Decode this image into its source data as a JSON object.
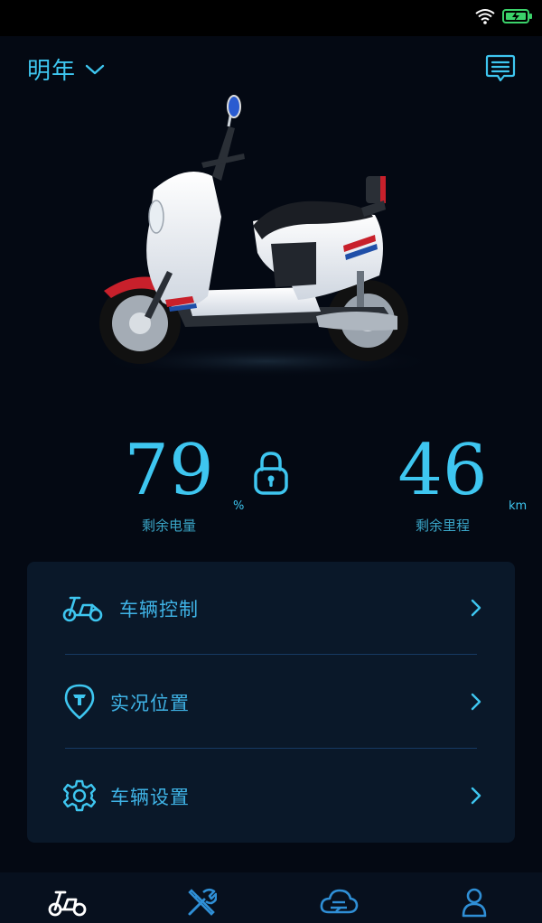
{
  "header": {
    "vehicle_name": "明年"
  },
  "stats": {
    "battery_value": "79",
    "battery_unit": "%",
    "battery_label": "剩余电量",
    "range_value": "46",
    "range_unit": "km",
    "range_label": "剩余里程"
  },
  "menu": {
    "items": [
      {
        "label": "车辆控制",
        "icon": "scooter-icon"
      },
      {
        "label": "实况位置",
        "icon": "location-pin-icon"
      },
      {
        "label": "车辆设置",
        "icon": "gear-icon"
      }
    ]
  },
  "tabbar": {
    "tabs": [
      {
        "icon": "scooter-icon",
        "active": true
      },
      {
        "icon": "tools-icon",
        "active": false
      },
      {
        "icon": "cloud-icon",
        "active": false
      },
      {
        "icon": "user-icon",
        "active": false
      }
    ]
  },
  "colors": {
    "accent": "#3ec6f0",
    "background": "#040913",
    "card": "#0a1829",
    "active_tab": "#ffffff"
  }
}
